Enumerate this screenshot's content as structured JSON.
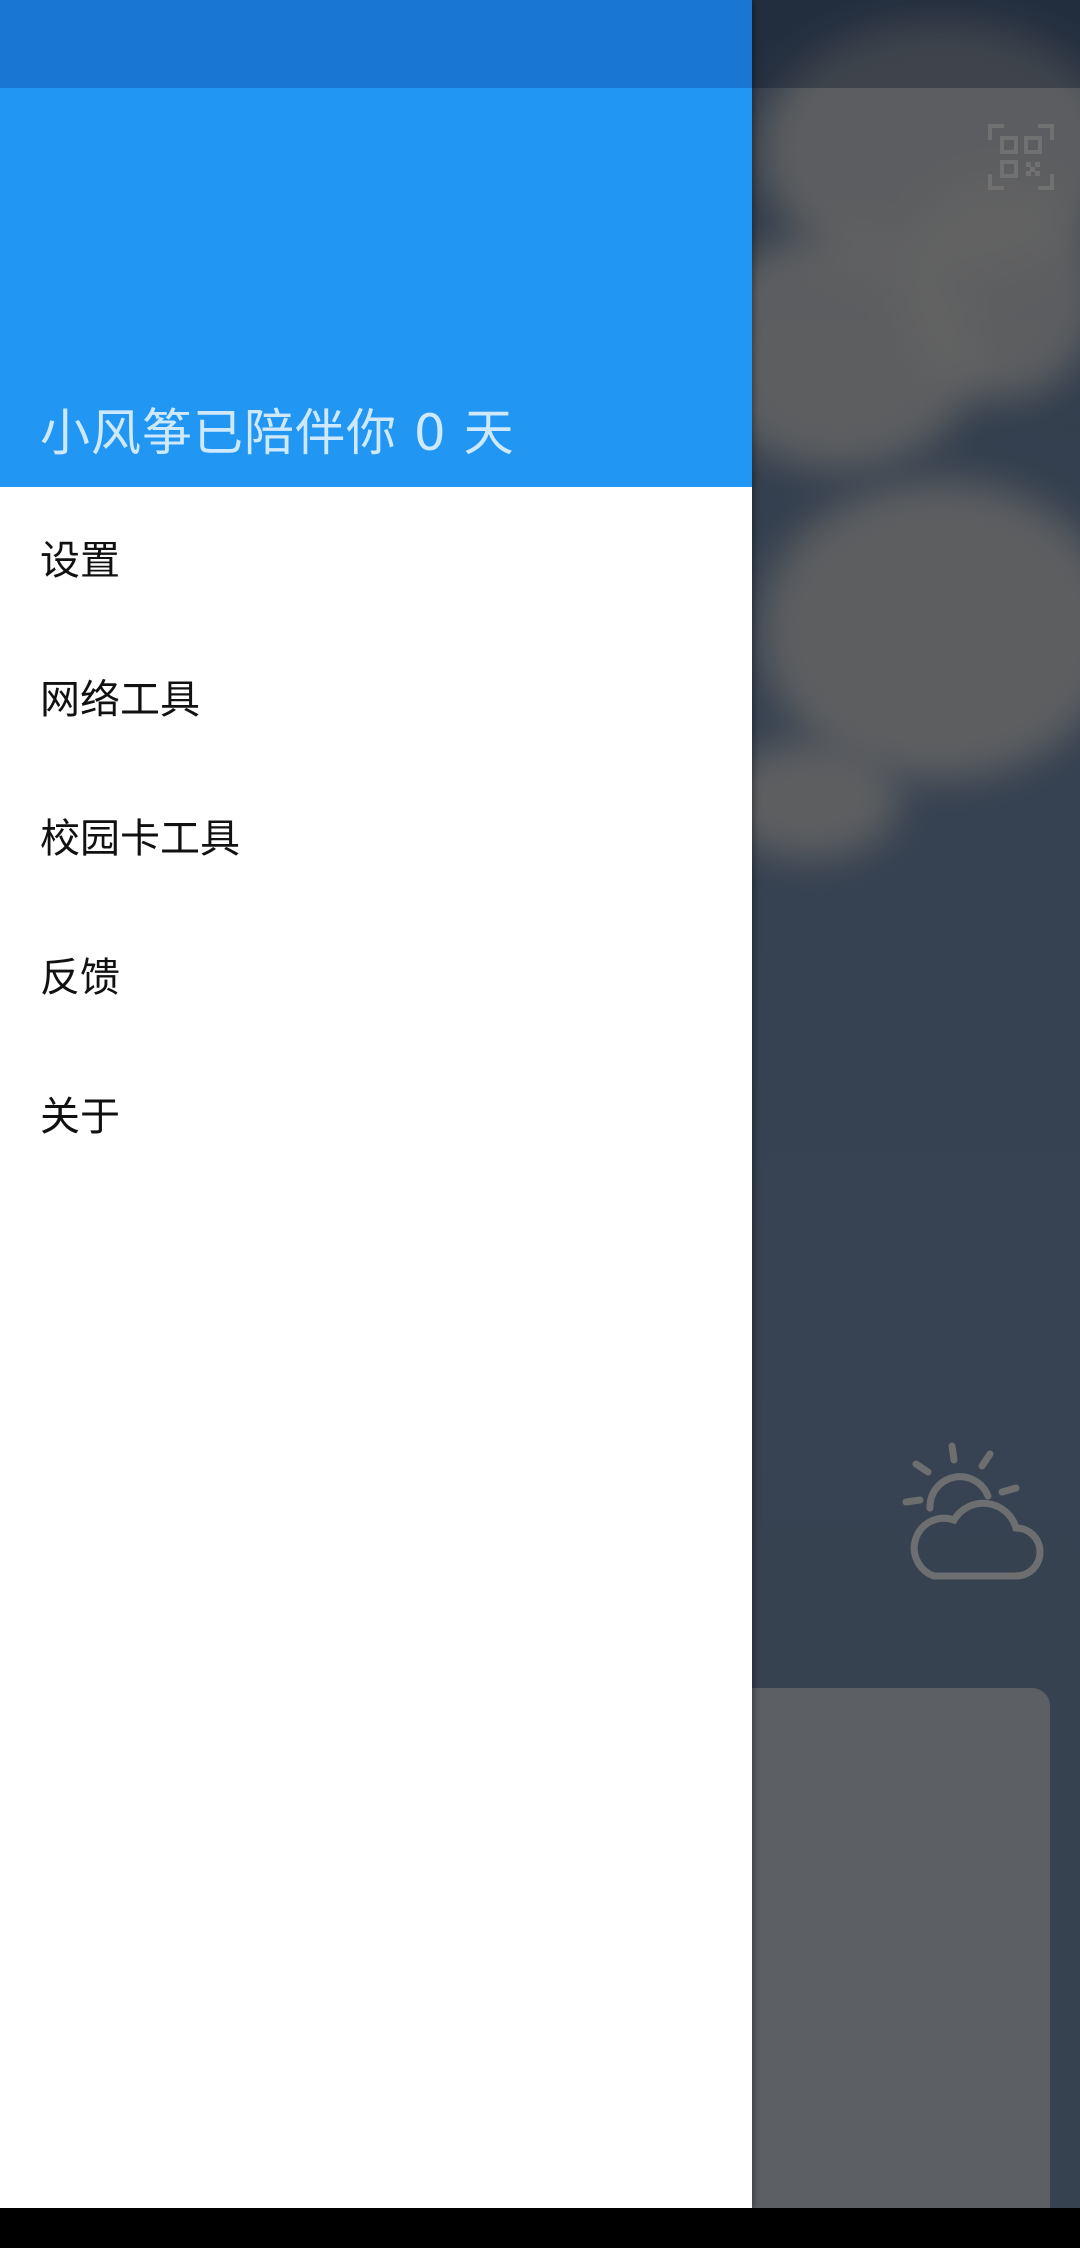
{
  "drawer": {
    "header_title": "小风筝已陪伴你 0 天",
    "menu": [
      {
        "label": "设置"
      },
      {
        "label": "网络工具"
      },
      {
        "label": "校园卡工具"
      },
      {
        "label": "反馈"
      },
      {
        "label": "关于"
      }
    ]
  },
  "background": {
    "qr_icon": "qr-scan-icon",
    "weather_icon": "partly-sunny-icon"
  },
  "colors": {
    "primary": "#2196f3",
    "primary_dark": "#1976d2"
  }
}
